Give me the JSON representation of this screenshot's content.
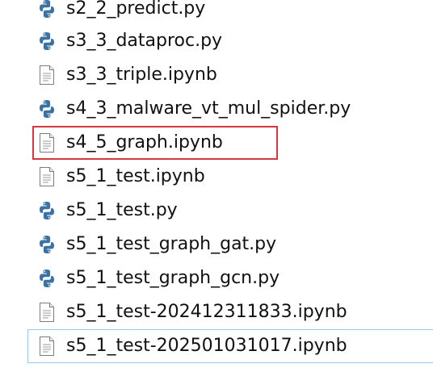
{
  "highlight_color": "#d9363e",
  "focus_color": "#99c8ea",
  "files": [
    {
      "name": "s2_2_predict.py",
      "icon": "python-file-icon"
    },
    {
      "name": "s3_3_dataproc.py",
      "icon": "python-file-icon"
    },
    {
      "name": "s3_3_triple.ipynb",
      "icon": "document-file-icon"
    },
    {
      "name": "s4_3_malware_vt_mul_spider.py",
      "icon": "python-file-icon"
    },
    {
      "name": "s4_5_graph.ipynb",
      "icon": "document-file-icon",
      "highlighted": true
    },
    {
      "name": "s5_1_test.ipynb",
      "icon": "document-file-icon"
    },
    {
      "name": "s5_1_test.py",
      "icon": "python-file-icon"
    },
    {
      "name": "s5_1_test_graph_gat.py",
      "icon": "python-file-icon"
    },
    {
      "name": "s5_1_test_graph_gcn.py",
      "icon": "python-file-icon"
    },
    {
      "name": "s5_1_test-202412311833.ipynb",
      "icon": "document-file-icon"
    },
    {
      "name": "s5_1_test-202501031017.ipynb",
      "icon": "document-file-icon",
      "focused": true
    }
  ]
}
